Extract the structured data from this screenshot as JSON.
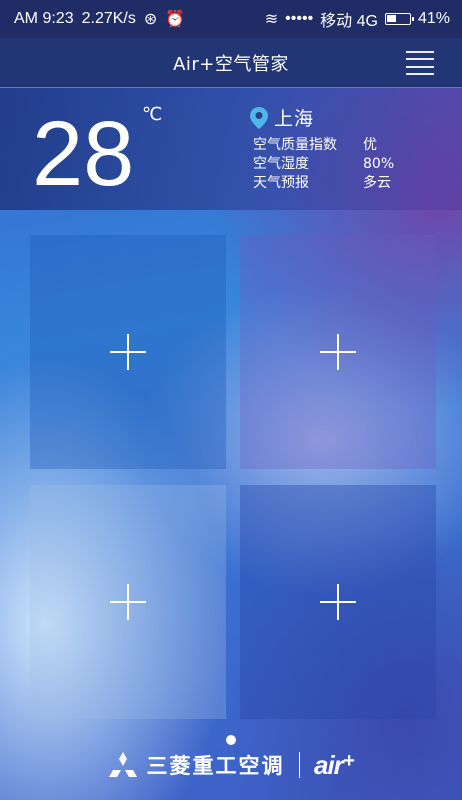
{
  "status_bar": {
    "time": "AM 9:23",
    "speed": "2.27K/s",
    "signal_dots": "•••••",
    "carrier": "移动 4G",
    "battery": "41%"
  },
  "header": {
    "title": "Air+空气管家"
  },
  "weather": {
    "temperature": "28",
    "unit": "℃",
    "city": "上海",
    "rows": [
      {
        "label": "空气质量指数",
        "value": "优"
      },
      {
        "label": "空气湿度",
        "value": "80%"
      },
      {
        "label": "天气预报",
        "value": "多云"
      }
    ]
  },
  "footer": {
    "brand": "三菱重工空调",
    "logo_text": "air",
    "logo_plus": "+"
  },
  "icons": {
    "menu": "hamburger-menu-icon",
    "location": "map-pin-icon",
    "add": "plus-icon",
    "brand_mark": "mitsubishi-diamonds-icon"
  }
}
